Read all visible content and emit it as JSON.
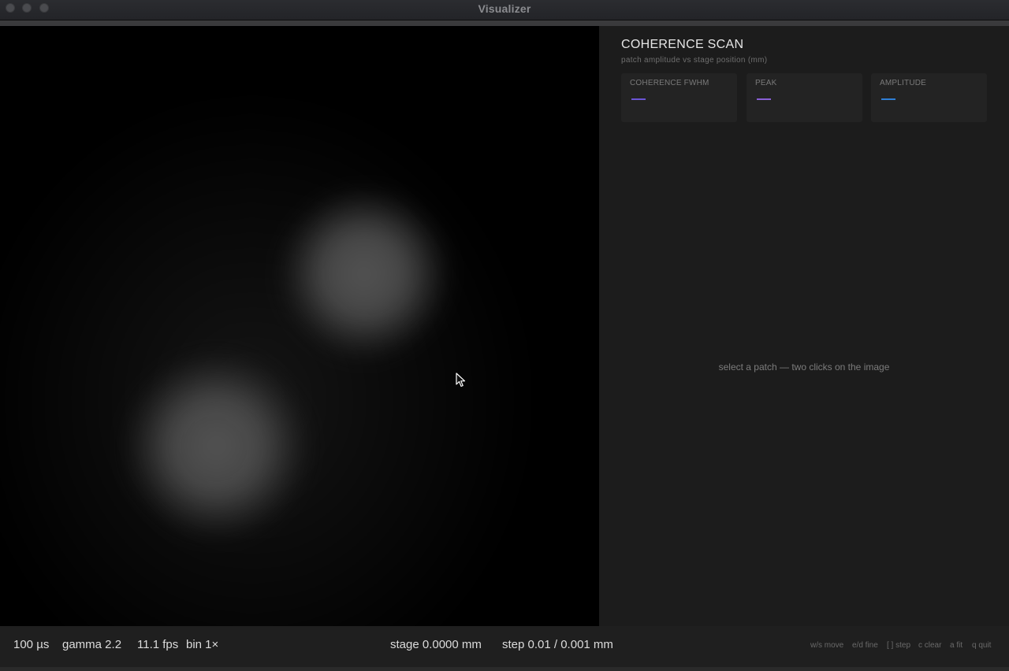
{
  "window": {
    "title": "Visualizer"
  },
  "panel": {
    "title": "COHERENCE SCAN",
    "subtitle": "patch amplitude vs stage position (mm)",
    "hint": "select a patch — two clicks on the image",
    "stats": [
      {
        "label": "COHERENCE FWHM",
        "value": "—",
        "color": "#6b55d6"
      },
      {
        "label": "PEAK",
        "value": "—",
        "color": "#8a5fd6"
      },
      {
        "label": "AMPLITUDE",
        "value": "—",
        "color": "#2f7fd6"
      }
    ]
  },
  "status": {
    "exposure": "100 µs",
    "gamma": "gamma 2.2",
    "fps": "11.1 fps",
    "bin": "bin 1×",
    "stage": "stage 0.0000 mm",
    "step": "step 0.01 / 0.001 mm"
  },
  "shortcuts": [
    "w/s move",
    "e/d fine",
    "[ ] step",
    "c clear",
    "a fit",
    "q quit"
  ],
  "icons": {
    "close": "traffic-light-close",
    "minimize": "traffic-light-minimize",
    "maximize": "traffic-light-maximize",
    "cursor": "mouse-pointer"
  }
}
